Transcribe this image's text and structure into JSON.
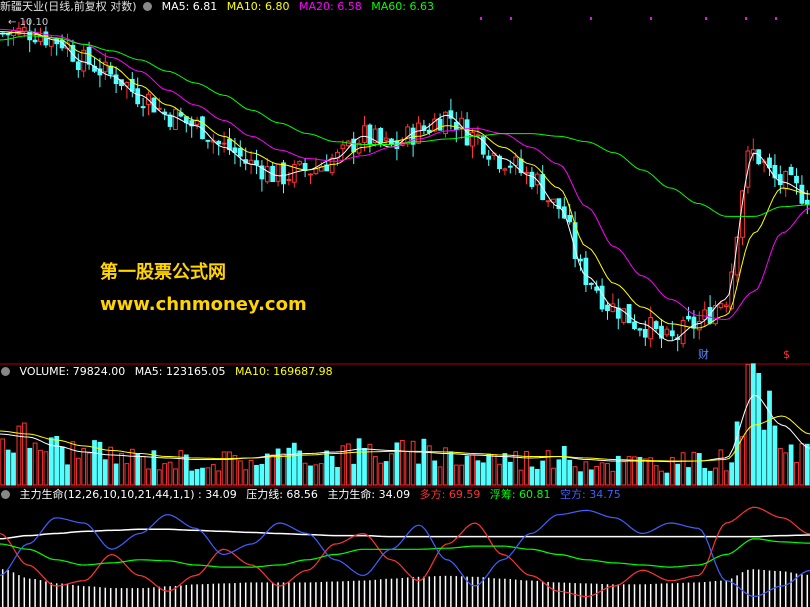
{
  "header": {
    "stock_label": "新疆天业(日线,前复权 对数)",
    "ma5": "MA5: 6.81",
    "ma10": "MA10: 6.80",
    "ma20": "MA20: 6.58",
    "ma60": "MA60: 6.63",
    "high_label": "10.10",
    "event_marker_1": "财",
    "event_marker_2": "$"
  },
  "volume_header": {
    "volume": "VOLUME: 79824.00",
    "ma5": "MA5: 123165.05",
    "ma10": "MA10: 169687.98"
  },
  "indicator_header": {
    "name": "主力生命(12,26,10,10,21,44,1,1) : 34.09",
    "pressure": "压力线: 68.56",
    "life": "主力生命: 34.09",
    "long": "多方: 69.59",
    "float": "浮筹: 60.81",
    "short": "空方: 34.75"
  },
  "watermark": {
    "cn": "第一股票公式网",
    "url": "www.chnmoney.com"
  },
  "colors": {
    "up": "#ff3333",
    "down": "#54ffff",
    "ma5": "#ffffff",
    "ma10": "#ffff00",
    "ma20": "#ff00ff",
    "ma60": "#00ff00",
    "separator": "#b00000",
    "long": "#ff3333",
    "float": "#00ff00",
    "short": "#4060ff",
    "pressure": "#ffffff"
  },
  "chart_data": [
    {
      "type": "candlestick",
      "title": "新疆天业(日线,前复权 对数)",
      "y_scale": "log",
      "ylim": [
        4.6,
        10.3
      ],
      "series": [
        {
          "name": "MA5",
          "values": [
            9.95,
            10.0,
            9.8,
            9.3,
            9.0,
            8.6,
            8.2,
            8.0,
            7.6,
            7.3,
            7.1,
            7.2,
            7.4,
            7.8,
            7.6,
            7.9,
            8.2,
            7.8,
            7.4,
            7.1,
            6.6,
            5.6,
            5.2,
            5.0,
            4.8,
            5.0,
            5.3,
            7.5,
            7.0,
            6.8
          ]
        },
        {
          "name": "MA10",
          "values": [
            10.0,
            9.95,
            9.85,
            9.5,
            9.2,
            8.8,
            8.4,
            8.1,
            7.8,
            7.5,
            7.3,
            7.2,
            7.3,
            7.6,
            7.7,
            7.8,
            8.0,
            7.9,
            7.6,
            7.3,
            6.9,
            6.0,
            5.5,
            5.2,
            5.0,
            4.95,
            5.1,
            6.2,
            6.9,
            6.8
          ]
        },
        {
          "name": "MA20",
          "values": [
            10.05,
            10.0,
            9.9,
            9.7,
            9.4,
            9.1,
            8.7,
            8.4,
            8.1,
            7.8,
            7.55,
            7.4,
            7.35,
            7.45,
            7.6,
            7.75,
            7.9,
            7.95,
            7.85,
            7.6,
            7.3,
            6.6,
            6.0,
            5.6,
            5.3,
            5.1,
            5.05,
            5.4,
            6.2,
            6.58
          ]
        },
        {
          "name": "MA60",
          "values": [
            9.8,
            9.9,
            9.85,
            9.7,
            9.55,
            9.35,
            9.1,
            8.85,
            8.6,
            8.3,
            8.05,
            7.85,
            7.7,
            7.65,
            7.65,
            7.7,
            7.75,
            7.8,
            7.85,
            7.85,
            7.8,
            7.7,
            7.5,
            7.2,
            6.9,
            6.65,
            6.45,
            6.45,
            6.6,
            6.63
          ]
        }
      ]
    },
    {
      "type": "bar",
      "title": "VOLUME",
      "series": [
        {
          "name": "MA5",
          "values": [
            170,
            160,
            130,
            110,
            100,
            95,
            90,
            85,
            85,
            90,
            100,
            105,
            110,
            120,
            115,
            110,
            105,
            100,
            95,
            90,
            95,
            85,
            80,
            80,
            78,
            80,
            90,
            300,
            200,
            123
          ]
        },
        {
          "name": "MA10",
          "values": [
            180,
            170,
            150,
            130,
            115,
            105,
            95,
            90,
            88,
            90,
            95,
            100,
            105,
            110,
            112,
            112,
            110,
            105,
            100,
            95,
            95,
            90,
            85,
            82,
            80,
            80,
            85,
            200,
            230,
            170
          ]
        }
      ]
    },
    {
      "type": "line",
      "title": "主力生命(12,26,10,10,21,44,1,1)",
      "series": [
        {
          "name": "压力线",
          "values": [
            65,
            68,
            70,
            72,
            73,
            74,
            74,
            73,
            72,
            71,
            70,
            69,
            68,
            68,
            67,
            67,
            67,
            67,
            67,
            67,
            67,
            67,
            67,
            67,
            67,
            67,
            67,
            67,
            68,
            68.56
          ]
        },
        {
          "name": "主力生命",
          "values": [
            40,
            30,
            25,
            22,
            20,
            20,
            22,
            24,
            25,
            26,
            26,
            26,
            27,
            28,
            30,
            32,
            33,
            32,
            30,
            28,
            26,
            25,
            24,
            24,
            25,
            26,
            28,
            40,
            38,
            34.09
          ]
        },
        {
          "name": "多方",
          "values": [
            70,
            40,
            20,
            25,
            50,
            30,
            15,
            30,
            55,
            40,
            20,
            35,
            60,
            70,
            45,
            25,
            60,
            80,
            50,
            30,
            15,
            10,
            20,
            35,
            25,
            30,
            80,
            95,
            85,
            69.59
          ]
        },
        {
          "name": "浮筹",
          "values": [
            60,
            55,
            45,
            40,
            42,
            45,
            44,
            40,
            38,
            38,
            40,
            45,
            50,
            55,
            55,
            55,
            56,
            58,
            58,
            55,
            50,
            45,
            42,
            40,
            38,
            40,
            50,
            65,
            62,
            60.81
          ]
        },
        {
          "name": "空方",
          "values": [
            30,
            60,
            85,
            80,
            55,
            70,
            88,
            75,
            50,
            60,
            80,
            70,
            45,
            30,
            55,
            78,
            45,
            20,
            45,
            70,
            88,
            92,
            85,
            70,
            80,
            75,
            25,
            10,
            20,
            34.75
          ]
        }
      ]
    }
  ]
}
